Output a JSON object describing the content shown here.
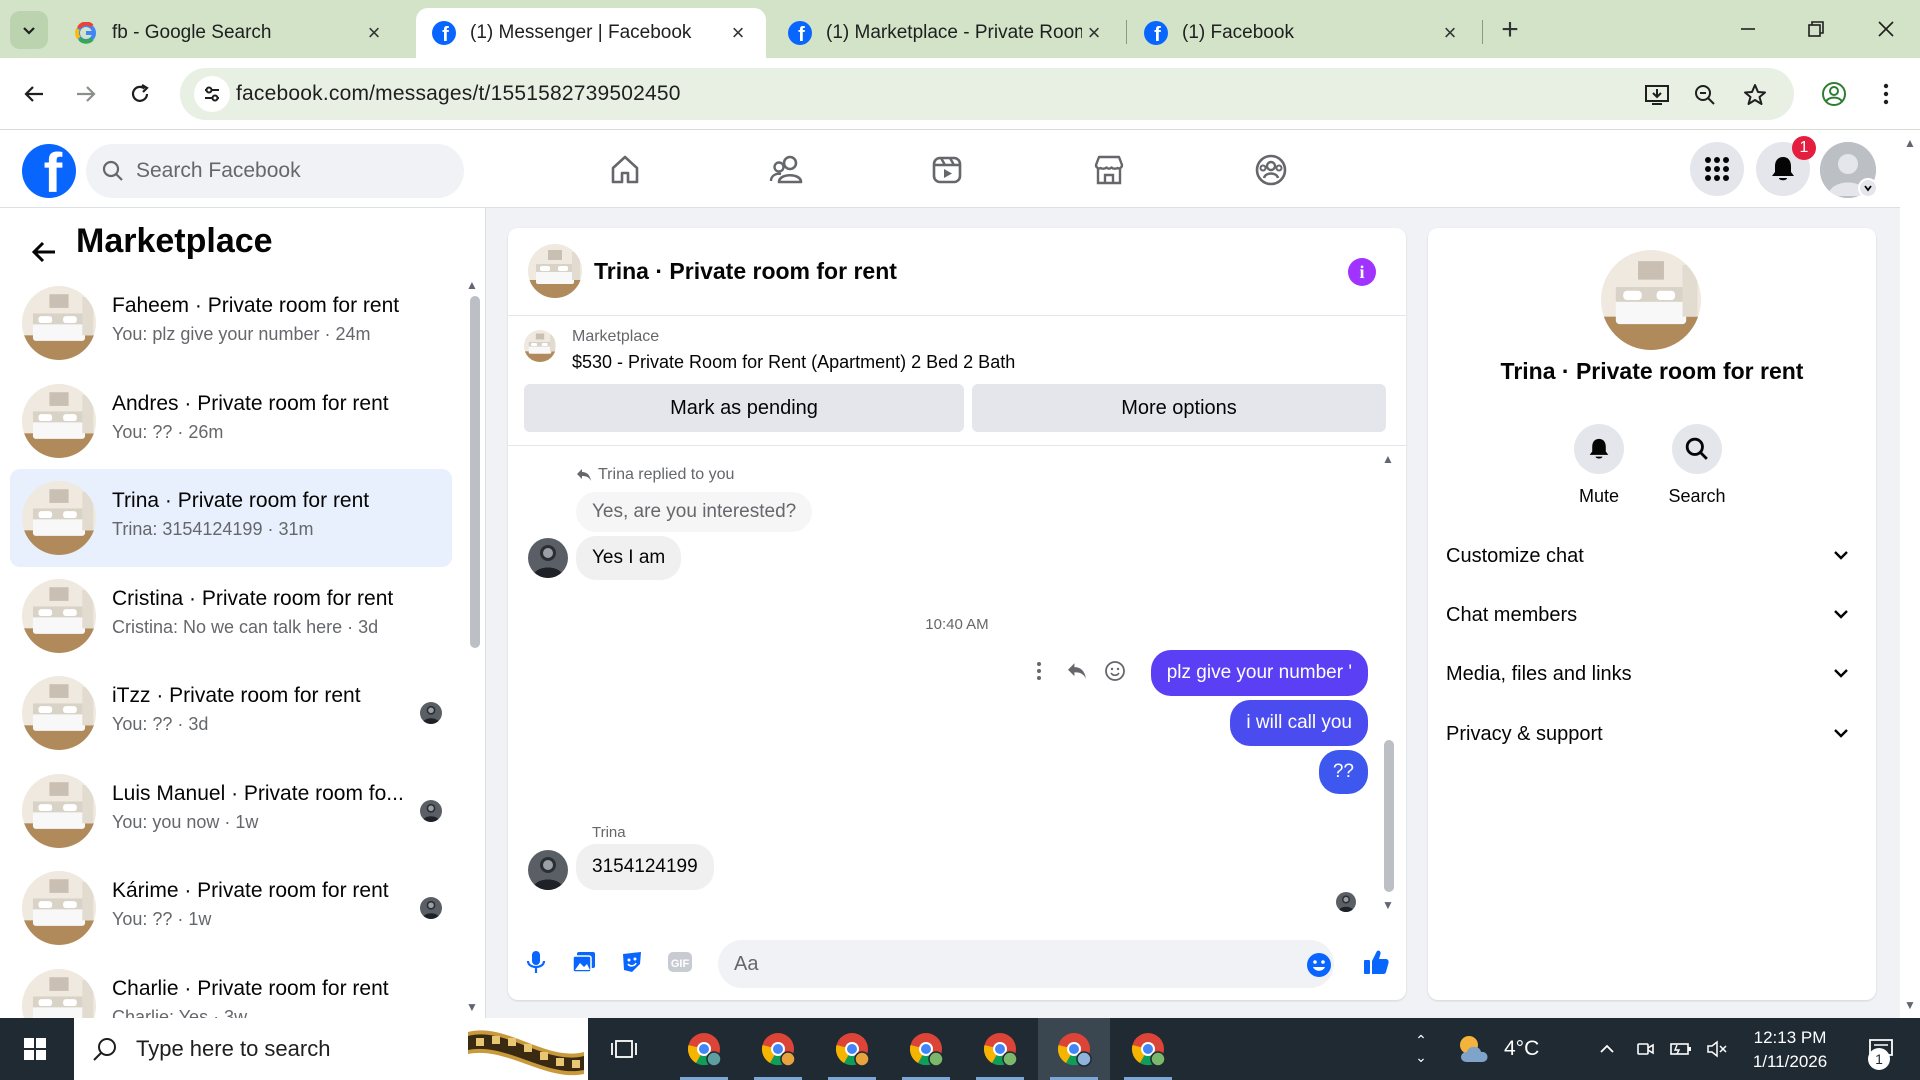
{
  "browser": {
    "tabs": [
      {
        "title": "fb - Google Search",
        "favicon": "google-icon",
        "active": false
      },
      {
        "title": "(1) Messenger | Facebook",
        "favicon": "facebook-icon",
        "active": true
      },
      {
        "title": "(1) Marketplace - Private Room",
        "favicon": "facebook-icon",
        "active": false
      },
      {
        "title": "(1) Facebook",
        "favicon": "facebook-icon",
        "active": false
      }
    ],
    "url": "facebook.com/messages/t/1551582739502450"
  },
  "facebook": {
    "search_placeholder": "Search Facebook",
    "notification_count": "1",
    "brand_color": "#0866ff"
  },
  "sidebar": {
    "title": "Marketplace",
    "conversations": [
      {
        "name": "Faheem · Private room for rent",
        "preview": "You: plz give your number · 24m",
        "selected": false,
        "seen_icon": ""
      },
      {
        "name": "Andres · Private room for rent",
        "preview": "You: ?? · 26m",
        "selected": false,
        "seen_icon": ""
      },
      {
        "name": "Trina · Private room for rent",
        "preview": "Trina: 3154124199 · 31m",
        "selected": true,
        "seen_icon": ""
      },
      {
        "name": "Cristina · Private room for rent",
        "preview": "Cristina: No we can talk here · 3d",
        "selected": false,
        "seen_icon": ""
      },
      {
        "name": "iTzz · Private room for rent",
        "preview": "You: ?? · 3d",
        "selected": false,
        "seen_icon": "seen-avatar-icon"
      },
      {
        "name": "Luis Manuel · Private room fo...",
        "preview": "You: you now · 1w",
        "selected": false,
        "seen_icon": "seen-avatar-icon"
      },
      {
        "name": "Kárime · Private room for rent",
        "preview": "You: ?? · 1w",
        "selected": false,
        "seen_icon": "seen-avatar-icon"
      },
      {
        "name": "Charlie · Private room for rent",
        "preview": "Charlie: Yes · 3w",
        "selected": false,
        "seen_icon": ""
      }
    ]
  },
  "chat": {
    "header_name": "Trina · Private room for rent",
    "listing_category": "Marketplace",
    "listing_title": "$530 - Private Room for Rent (Apartment) 2 Bed 2 Bath",
    "mark_pending_label": "Mark as pending",
    "more_options_label": "More options",
    "replied_note": "Trina replied to you",
    "quoted_message": "Yes, are you interested?",
    "reply_message": "Yes I am",
    "timestamp": "10:40 AM",
    "outgoing": [
      "plz give your number '",
      "i will call you",
      "??"
    ],
    "incoming_sender": "Trina",
    "incoming_message": "3154124199",
    "composer_placeholder": "Aa",
    "accent_color": "#5b3ff5"
  },
  "info_panel": {
    "name": "Trina · Private room for rent",
    "actions": [
      {
        "label": "Mute",
        "icon": "bell-icon"
      },
      {
        "label": "Search",
        "icon": "search-icon"
      }
    ],
    "sections": [
      "Customize chat",
      "Chat members",
      "Media, files and links",
      "Privacy & support"
    ]
  },
  "taskbar": {
    "search_placeholder": "Type here to search",
    "weather": "4°C",
    "time": "12:13 PM",
    "date": "1/11/2026",
    "notification_count": "1"
  }
}
